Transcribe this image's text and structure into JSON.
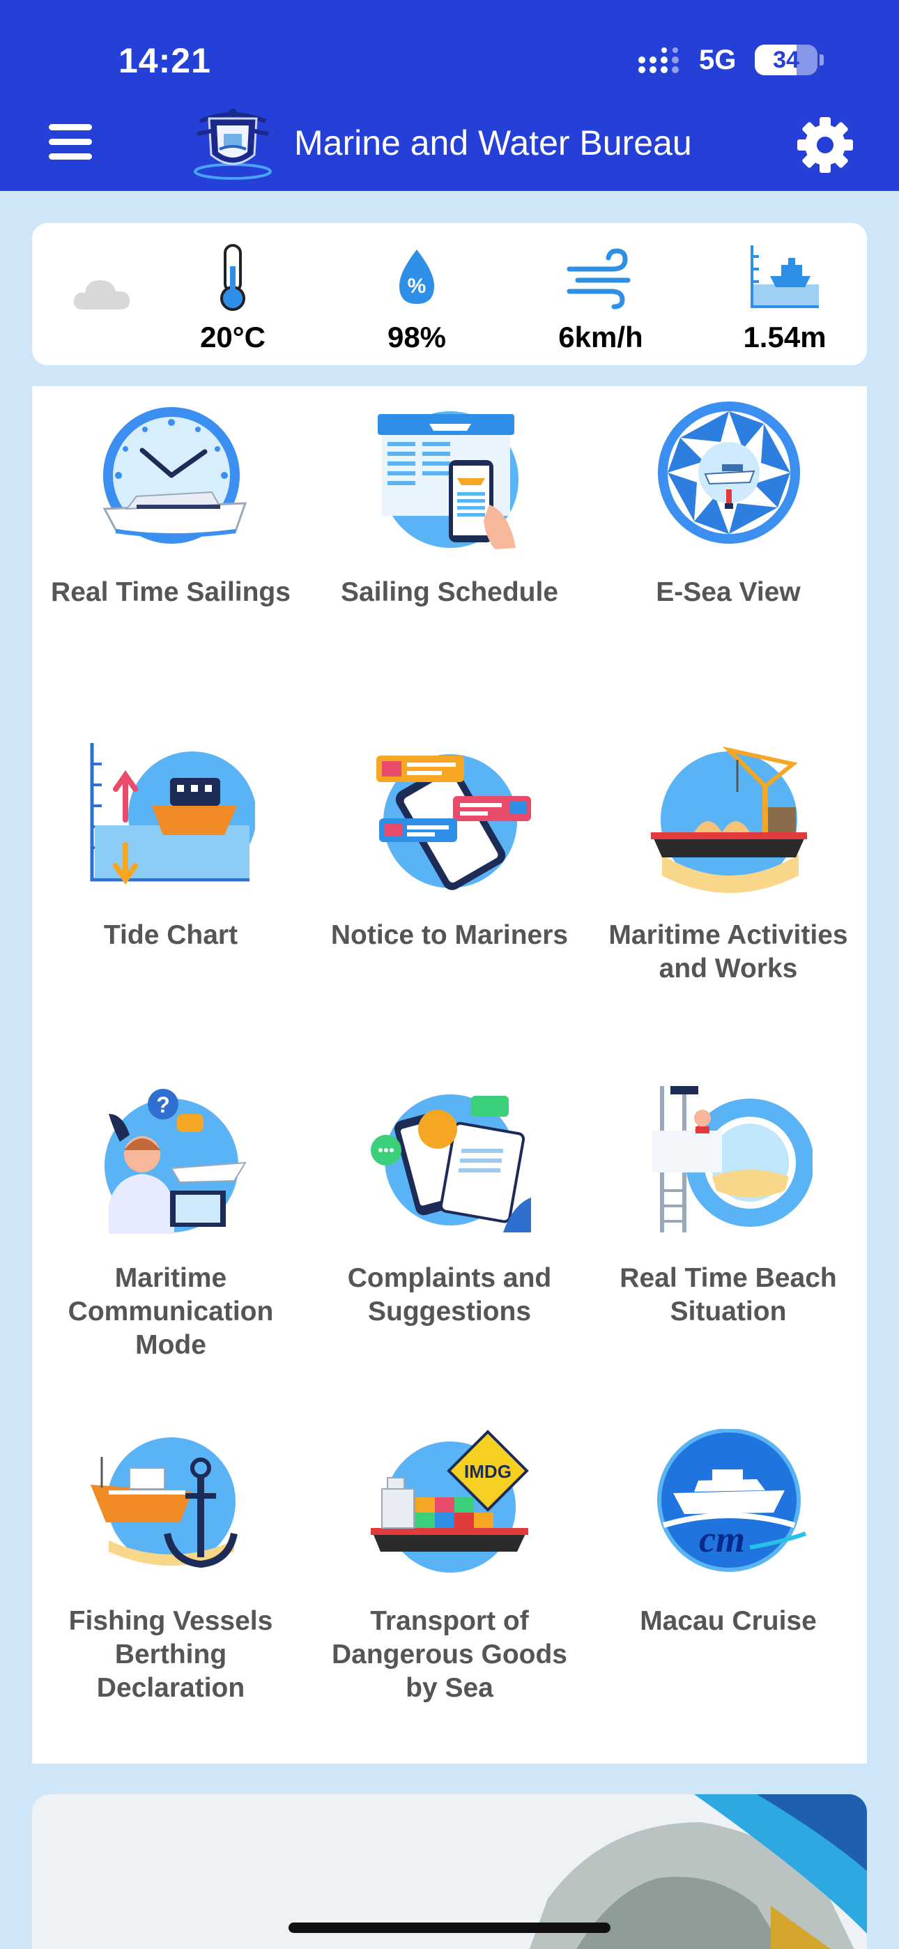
{
  "status_bar": {
    "time": "14:21",
    "network": "5G",
    "battery": "34"
  },
  "header": {
    "title": "Marine and Water Bureau",
    "menu_icon": "hamburger-menu-icon",
    "settings_icon": "gear-icon",
    "logo": "bureau-crest-logo"
  },
  "weather": {
    "temperature": "20°C",
    "humidity": "98%",
    "wind": "6km/h",
    "tide": "1.54m"
  },
  "services": [
    {
      "label": "Real Time Sailings",
      "icon": "ferry-clock-icon"
    },
    {
      "label": "Sailing Schedule",
      "icon": "schedule-phone-icon"
    },
    {
      "label": "E-Sea View",
      "icon": "camera-shutter-ship-icon"
    },
    {
      "label": "Tide Chart",
      "icon": "tide-chart-icon"
    },
    {
      "label": "Notice to Mariners",
      "icon": "notice-phone-icon"
    },
    {
      "label": "Maritime Activities and Works",
      "icon": "crane-barge-icon"
    },
    {
      "label": "Maritime Communication Mode",
      "icon": "call-center-icon"
    },
    {
      "label": "Complaints and Suggestions",
      "icon": "complaint-clipboard-icon"
    },
    {
      "label": "Real Time Beach Situation",
      "icon": "lifeguard-tower-icon"
    },
    {
      "label": "Fishing Vessels Berthing Declaration",
      "icon": "fishing-boat-anchor-icon"
    },
    {
      "label": "Transport of Dangerous Goods by Sea",
      "icon": "imdg-container-ship-icon",
      "sign": "IMDG"
    },
    {
      "label": "Macau Cruise",
      "icon": "macau-cruise-logo-icon",
      "logo_text": "cm"
    }
  ],
  "colors": {
    "header": "#2440d6",
    "background": "#cfe6f8",
    "label": "#555555",
    "icon_blue": "#2e8fe6"
  }
}
